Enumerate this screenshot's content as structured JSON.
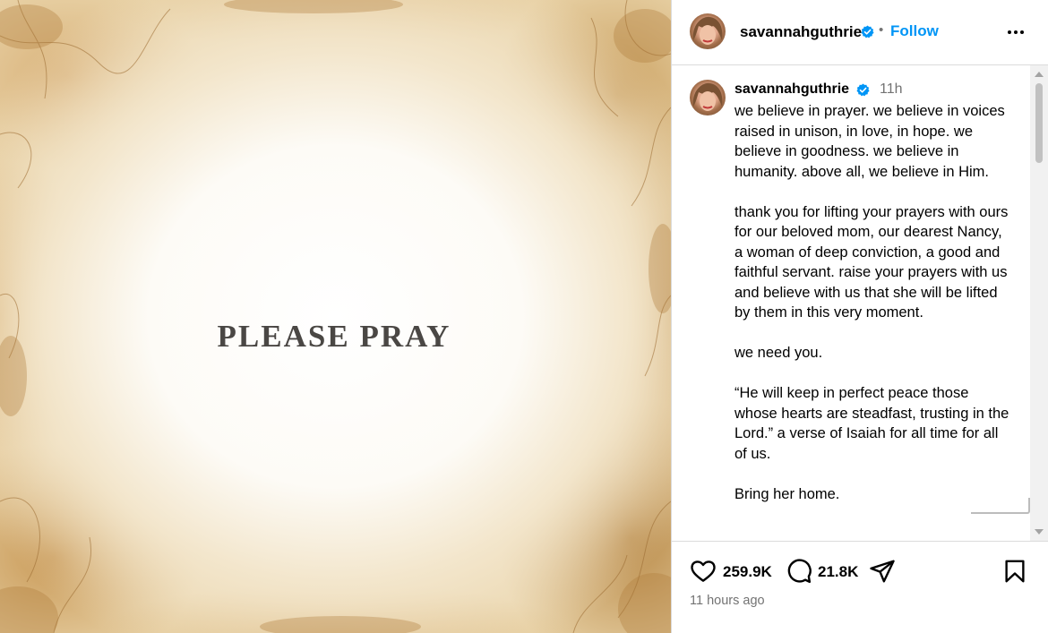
{
  "image": {
    "headline": "PLEASE PRAY"
  },
  "header": {
    "username": "savannahguthrie",
    "separator": "•",
    "follow_label": "Follow",
    "more_icon": "more-options-icon"
  },
  "caption": {
    "username": "savannahguthrie",
    "time_ago": "11h",
    "text": "we believe in prayer. we believe in voices raised in unison, in love, in hope. we believe in goodness. we believe in humanity. above all, we believe in Him.\n\nthank you for lifting your prayers with ours for our beloved mom, our dearest Nancy, a woman of deep conviction, a good and faithful servant. raise your prayers with us and believe with us that she will be lifted by them in this very moment.\n\nwe need you.\n\n“He will keep in perfect peace those whose hearts are steadfast, trusting in the Lord.” a verse of Isaiah for all time for all of us.\n\nBring her home."
  },
  "actions": {
    "like_count": "259.9K",
    "comment_count": "21.8K",
    "posted": "11 hours ago"
  },
  "colors": {
    "follow": "#0095f6",
    "verified": "#0095f6",
    "muted": "#737373",
    "divider": "#dbdbdb"
  }
}
